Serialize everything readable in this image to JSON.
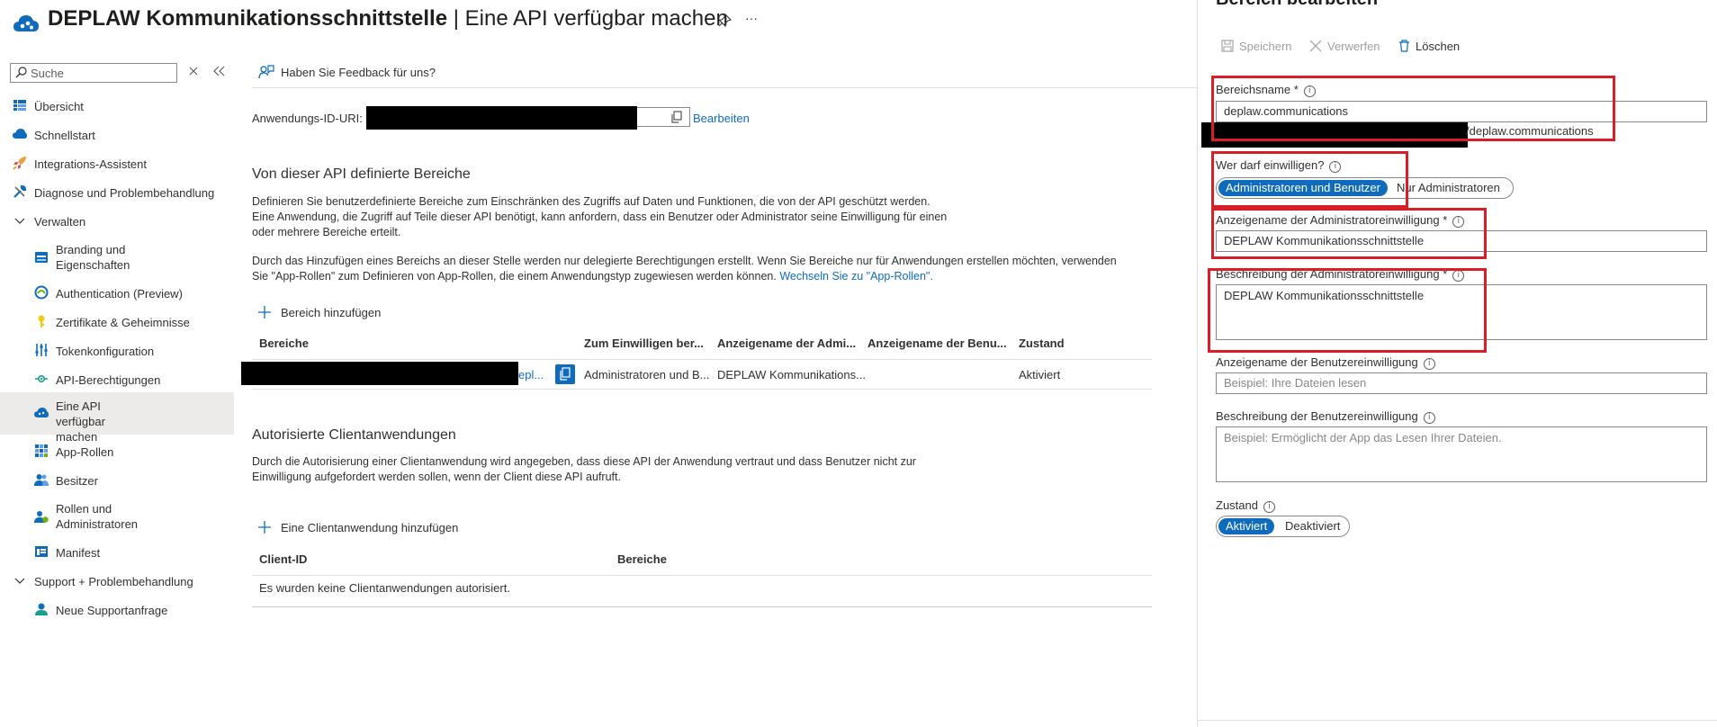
{
  "header": {
    "app_name": "DEPLAW Kommunikationsschnittstelle",
    "separator": " | ",
    "page_title": "Eine API verfügbar machen",
    "more_label": "···"
  },
  "sidebar": {
    "search_placeholder": "Suche",
    "items": [
      {
        "label": "Übersicht"
      },
      {
        "label": "Schnellstart"
      },
      {
        "label": "Integrations-Assistent"
      },
      {
        "label": "Diagnose und Problembehandlung"
      },
      {
        "label": "Verwalten"
      },
      {
        "label": "Branding und Eigenschaften"
      },
      {
        "label": "Authentication (Preview)"
      },
      {
        "label": "Zertifikate & Geheimnisse"
      },
      {
        "label": "Tokenkonfiguration"
      },
      {
        "label": "API-Berechtigungen"
      },
      {
        "label": "Eine API verfügbar machen"
      },
      {
        "label": "App-Rollen"
      },
      {
        "label": "Besitzer"
      },
      {
        "label": "Rollen und Administratoren"
      },
      {
        "label": "Manifest"
      },
      {
        "label": "Support + Problembehandlung"
      },
      {
        "label": "Neue Supportanfrage"
      }
    ]
  },
  "main": {
    "feedback_label": "Haben Sie Feedback für uns?",
    "app_id_uri_label": "Anwendungs-ID-URI:",
    "edit_link": "Bearbeiten",
    "scopes_heading": "Von dieser API definierte Bereiche",
    "scopes_desc_1": "Definieren Sie benutzerdefinierte Bereiche zum Einschränken des Zugriffs auf Daten und Funktionen, die von der API geschützt werden.",
    "scopes_desc_2": "Eine Anwendung, die Zugriff auf Teile dieser API benötigt, kann anfordern, dass ein Benutzer oder Administrator seine Einwilligung für einen",
    "scopes_desc_3": "oder mehrere Bereiche erteilt.",
    "delegated_desc_1": "Durch das Hinzufügen eines Bereichs an dieser Stelle werden nur delegierte Berechtigungen erstellt. Wenn Sie Bereiche nur für Anwendungen erstellen möchten, verwenden",
    "delegated_desc_2": "Sie \"App-Rollen\" zum Definieren von App-Rollen, die einem Anwendungstyp zugewiesen werden können. ",
    "app_roles_link": "Wechseln Sie zu \"App-Rollen\".",
    "add_scope_label": "Bereich hinzufügen",
    "scopes_table": {
      "headers": [
        "Bereiche",
        "Zum Einwilligen ber...",
        "Anzeigename der Admi...",
        "Anzeigename der Benu...",
        "Zustand"
      ],
      "rows": [
        {
          "scope_suffix": "epl...",
          "consent": "Administratoren und B...",
          "admin_display": "DEPLAW Kommunikations...",
          "user_display": "",
          "state": "Aktiviert"
        }
      ]
    },
    "clients_heading": "Autorisierte Clientanwendungen",
    "clients_desc_1": "Durch die Autorisierung einer Clientanwendung wird angegeben, dass diese API der Anwendung vertraut und dass Benutzer nicht zur",
    "clients_desc_2": "Einwilligung aufgefordert werden sollen, wenn der Client diese API aufruft.",
    "add_client_label": "Eine Clientanwendung hinzufügen",
    "clients_table": {
      "headers": [
        "Client-ID",
        "Bereiche"
      ],
      "empty": "Es wurden keine Clientanwendungen autorisiert."
    }
  },
  "panel": {
    "title": "Bereich bearbeiten",
    "toolbar": {
      "save": "Speichern",
      "discard": "Verwerfen",
      "delete": "Löschen"
    },
    "scope_name_label": "Bereichsname *",
    "scope_name_value": "deplaw.communications",
    "scope_full_suffix": "/deplaw.communications",
    "consent_label": "Wer darf einwilligen?",
    "consent_options": [
      "Administratoren und Benutzer",
      "Nur Administratoren"
    ],
    "admin_display_label": "Anzeigename der Administratoreinwilligung *",
    "admin_display_value": "DEPLAW Kommunikationsschnittstelle",
    "admin_desc_label": "Beschreibung der Administratoreinwilligung *",
    "admin_desc_value": "DEPLAW Kommunikationsschnittstelle",
    "user_display_label": "Anzeigename der Benutzereinwilligung",
    "user_display_placeholder": "Beispiel: Ihre Dateien lesen",
    "user_desc_label": "Beschreibung der Benutzereinwilligung",
    "user_desc_placeholder": "Beispiel: Ermöglicht der App das Lesen Ihrer Dateien.",
    "state_label": "Zustand",
    "state_options": [
      "Aktiviert",
      "Deaktiviert"
    ]
  },
  "colors": {
    "accent": "#0f6cbd",
    "highlight_box": "#d61f29",
    "active_nav": "#edebe9"
  }
}
